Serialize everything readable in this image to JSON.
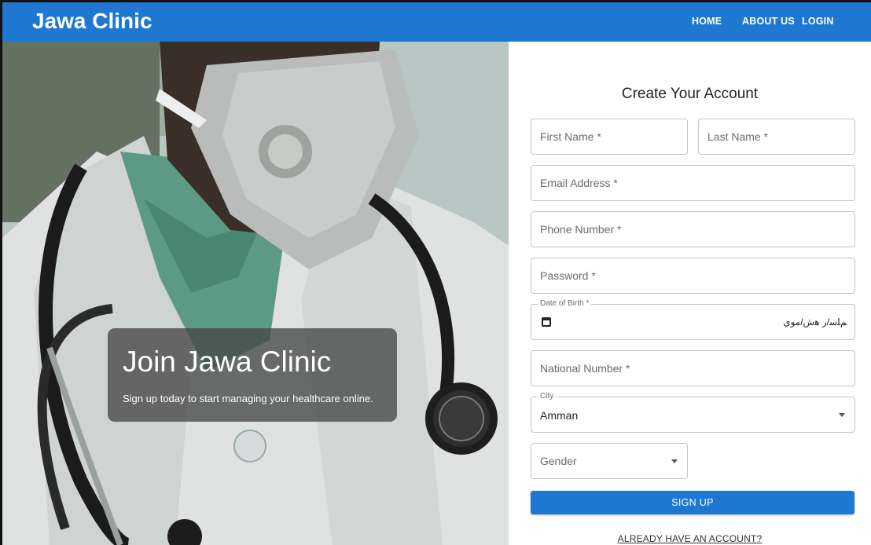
{
  "header": {
    "brand": "Jawa Clinic",
    "nav": {
      "home": "HOME",
      "about": "ABOUT US",
      "login": "LOGIN"
    }
  },
  "hero": {
    "title": "Join Jawa Clinic",
    "subtitle": "Sign up today to start managing your healthcare online."
  },
  "form": {
    "title": "Create Your Account",
    "first_name": "First Name *",
    "last_name": "Last Name *",
    "email": "Email Address *",
    "phone": "Phone Number *",
    "password": "Password *",
    "dob_label": "Date of Birth *",
    "dob_placeholder": "ﻢﻠﺳ/ﺭ ﻫﺵ/ﻣﻮﻱ",
    "national_number": "National Number *",
    "city_label": "City",
    "city_value": "Amman",
    "gender": "Gender",
    "submit": "SIGN UP",
    "login_link": "ALREADY HAVE AN ACCOUNT?"
  },
  "colors": {
    "primary": "#1e78d2",
    "overlay": "#464646"
  }
}
